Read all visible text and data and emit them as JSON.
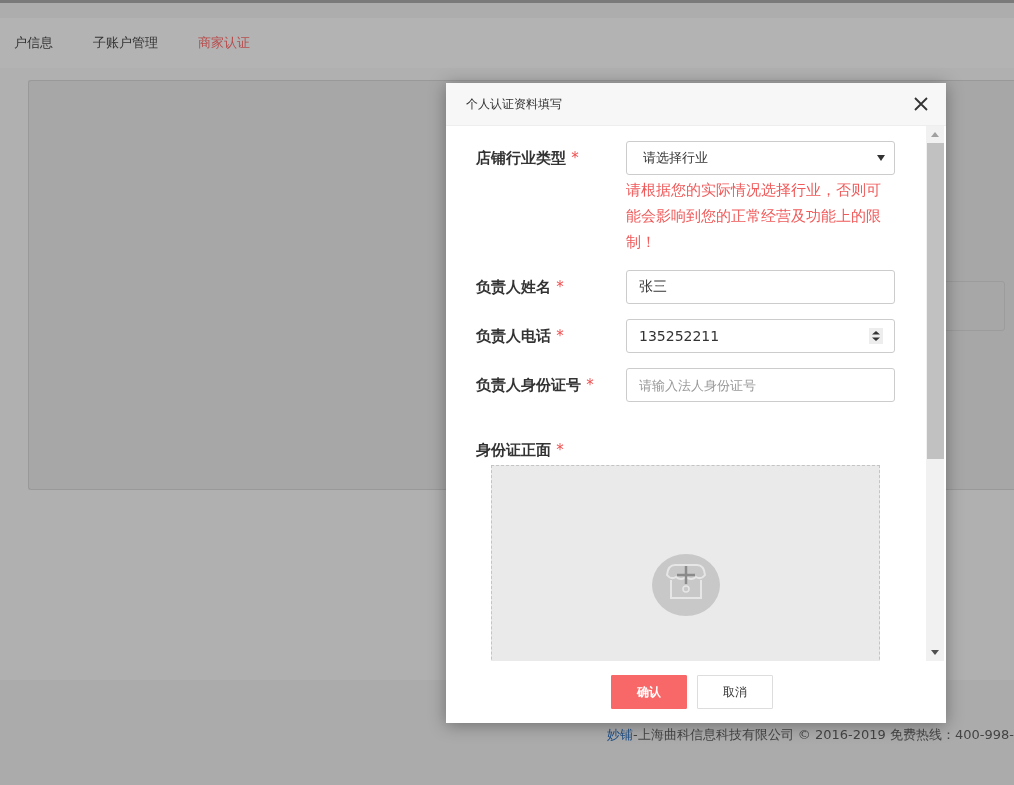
{
  "background_page": {
    "tabs": [
      {
        "label": "户信息",
        "selected": false
      },
      {
        "label": "子账户管理",
        "selected": false
      },
      {
        "label": "商家认证",
        "selected": true
      }
    ]
  },
  "footer": {
    "brand_link": "妙铺",
    "text": "-上海曲科信息科技有限公司 © 2016-2019 免费热线：400-998-"
  },
  "dialog": {
    "title": "个人认证资料填写",
    "fields": [
      {
        "kind": "select",
        "label": "店铺行业类型",
        "required_mark": "*",
        "placeholder": "请选择行业",
        "hint": "请根据您的实际情况选择行业，否则可能会影响到您的正常经营及功能上的限制！"
      },
      {
        "kind": "text",
        "label": "负责人姓名",
        "required_mark": "*",
        "value": "张三"
      },
      {
        "kind": "number",
        "label": "负责人电话",
        "required_mark": "*",
        "value": "135252211"
      },
      {
        "kind": "text",
        "label": "负责人身份证号",
        "required_mark": "*",
        "placeholder": "请输入法人身份证号"
      },
      {
        "kind": "upload",
        "label": "身份证正面",
        "required_mark": "*"
      }
    ],
    "buttons": [
      {
        "label": "确认",
        "kind": "primary"
      },
      {
        "label": "取消",
        "kind": "default"
      }
    ]
  }
}
